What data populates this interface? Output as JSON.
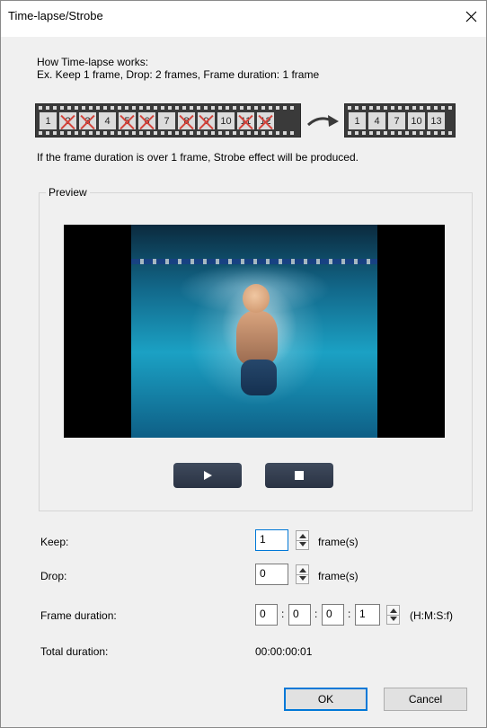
{
  "window": {
    "title": "Time-lapse/Strobe"
  },
  "intro": {
    "heading": "How Time-lapse works:",
    "example": "Ex. Keep 1 frame, Drop: 2 frames, Frame duration: 1 frame",
    "note": "If the frame duration is over 1 frame, Strobe effect will be produced."
  },
  "strip_before": [
    {
      "label": "1",
      "dropped": false
    },
    {
      "label": "2",
      "dropped": true
    },
    {
      "label": "3",
      "dropped": true
    },
    {
      "label": "4",
      "dropped": false
    },
    {
      "label": "5",
      "dropped": true
    },
    {
      "label": "6",
      "dropped": true
    },
    {
      "label": "7",
      "dropped": false
    },
    {
      "label": "8",
      "dropped": true
    },
    {
      "label": "9",
      "dropped": true
    },
    {
      "label": "10",
      "dropped": false
    },
    {
      "label": "11",
      "dropped": true
    },
    {
      "label": "12",
      "dropped": true
    }
  ],
  "strip_after": [
    "1",
    "4",
    "7",
    "10",
    "13"
  ],
  "preview": {
    "label": "Preview"
  },
  "fields": {
    "keep": {
      "label": "Keep:",
      "value": "1",
      "unit": "frame(s)"
    },
    "drop": {
      "label": "Drop:",
      "value": "0",
      "unit": "frame(s)"
    },
    "frame_duration": {
      "label": "Frame duration:",
      "h": "0",
      "m": "0",
      "s": "0",
      "f": "1",
      "sep": ":",
      "unit": "(H:M:S:f)"
    },
    "total_duration": {
      "label": "Total duration:",
      "value": "00:00:00:01"
    }
  },
  "buttons": {
    "ok": "OK",
    "cancel": "Cancel"
  },
  "icons": {
    "close": "close-icon",
    "play": "play-icon",
    "stop": "stop-icon",
    "arrow": "curved-arrow-icon"
  }
}
